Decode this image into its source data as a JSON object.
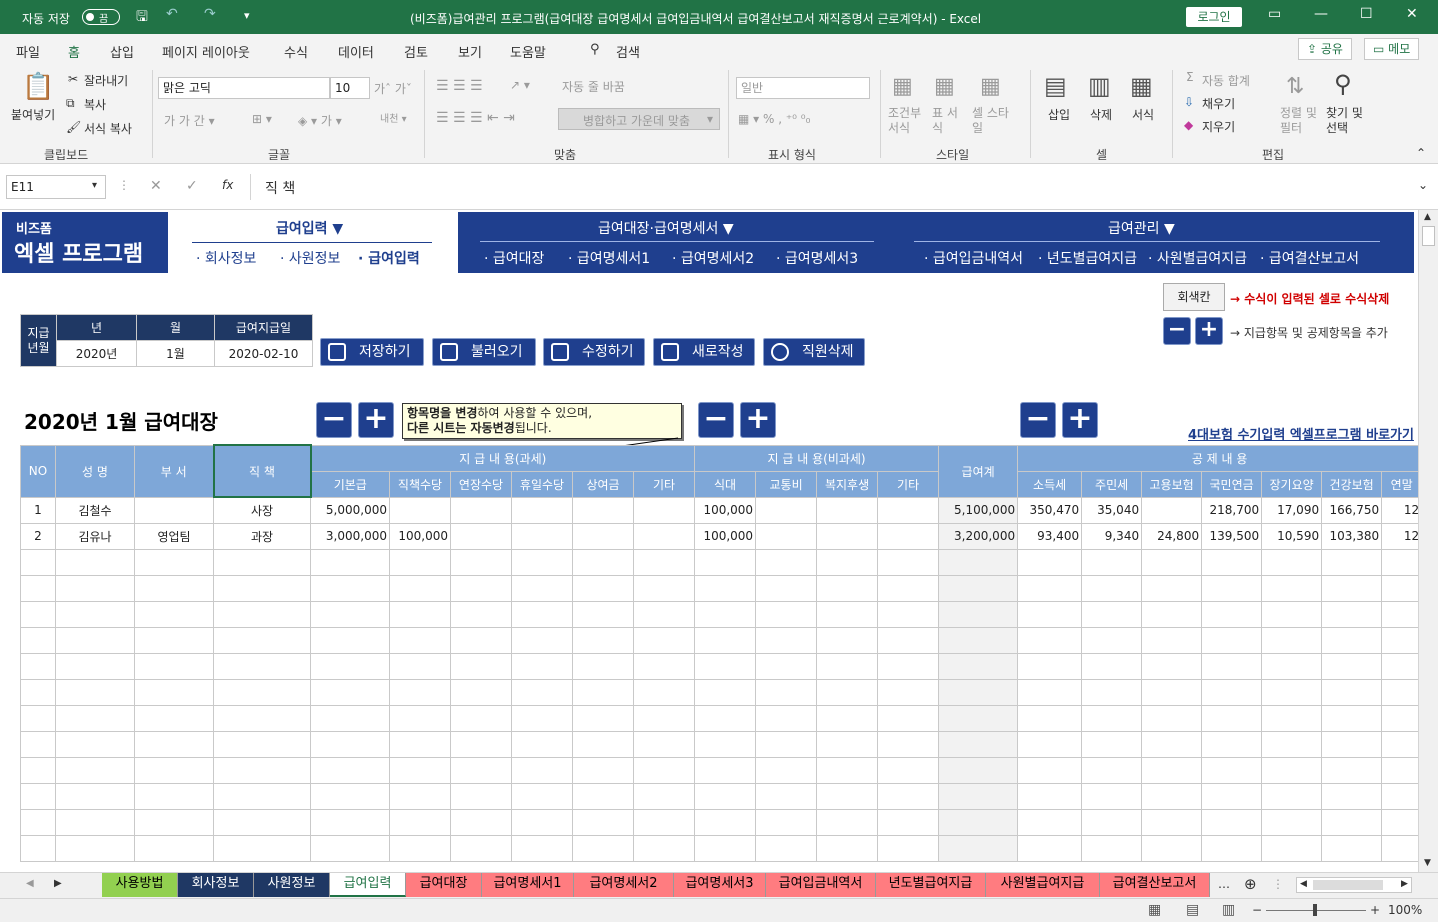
{
  "titlebar": {
    "autosave_label": "자동 저장",
    "autosave_state": "끔",
    "title": "(비즈폼)급여관리 프로그램(급여대장 급여명세서 급여입금내역서 급여결산보고서 재직증명서 근로계약서)  -  Excel",
    "login": "로그인"
  },
  "ribbon_tabs": [
    "파일",
    "홈",
    "삽입",
    "페이지 레이아웃",
    "수식",
    "데이터",
    "검토",
    "보기",
    "도움말",
    "검색"
  ],
  "ribbon_share": "공유",
  "ribbon_memo": "메모",
  "ribbon": {
    "paste": "붙여넣기",
    "cut": "잘라내기",
    "copy": "복사",
    "format_painter": "서식 복사",
    "clipboard": "클립보드",
    "font_name": "맑은 고딕",
    "font_size": "10",
    "font": "글꼴",
    "wrap": "자동 줄 바꿈",
    "merge": "병합하고 가운데 맞춤",
    "align": "맞춤",
    "number_format": "일반",
    "number": "표시 형식",
    "cond_format": "조건부 서식",
    "table_format": "표 서식",
    "cell_style": "셀 스타일",
    "style": "스타일",
    "insert": "삽입",
    "delete": "삭제",
    "format": "서식",
    "cells": "셀",
    "autosum": "자동 합계",
    "fill": "채우기",
    "clear": "지우기",
    "sort": "정렬 및 필터",
    "find": "찾기 및 선택",
    "edit": "편집"
  },
  "formula_bar": {
    "name_box": "E11",
    "fx": "fx",
    "content": "직 책"
  },
  "banner": {
    "logo_small": "비즈폼",
    "logo_big": "엑셀 프로그램",
    "group1_title": "급여입력 ▼",
    "group1_items": [
      "· 회사정보",
      "· 사원정보",
      "· 급여입력"
    ],
    "group2_title": "급여대장·급여명세서 ▼",
    "group2_items": [
      "· 급여대장",
      "· 급여명세서1",
      "· 급여명세서2",
      "· 급여명세서3"
    ],
    "group3_title": "급여관리 ▼",
    "group3_items": [
      "· 급여입금내역서",
      "· 년도별급여지급",
      "· 사원별급여지급",
      "· 급여결산보고서"
    ]
  },
  "legend": {
    "color_cell": "회색칸",
    "formula_note": "→ 수식이 입력된 셀로 수식삭제",
    "addrow_note": "→ 지급항목 및 공제항목을 추가"
  },
  "pay_period": {
    "label1": "지급",
    "label2": "년월",
    "year_h": "년",
    "month_h": "월",
    "date_h": "급여지급일",
    "year": "2020년",
    "month": "1월",
    "date": "2020-02-10"
  },
  "actions": [
    "저장하기",
    "불러오기",
    "수정하기",
    "새로작성",
    "직원삭제"
  ],
  "sheet_title": "2020년 1월 급여대장",
  "note": {
    "line1_bold": "항목명을 변경",
    "line1": "하여 사용할 수 있으며,",
    "line2_bold": "다른 시트는 자동변경",
    "line2": "됩니다."
  },
  "link": "4대보험 수기입력 엑셀프로그램 바로가기",
  "table": {
    "h_no": "NO",
    "h_name": "성 명",
    "h_dept": "부 서",
    "h_pos": "직 책",
    "h_taxable": "지 급 내 용(과세)",
    "h_nontaxable": "지 급 내 용(비과세)",
    "h_total": "급여계",
    "h_deduct": "공 제 내 용",
    "sub_taxable": [
      "기본급",
      "직책수당",
      "연장수당",
      "휴일수당",
      "상여금",
      "기타"
    ],
    "sub_nontaxable": [
      "식대",
      "교통비",
      "복지후생",
      "기타"
    ],
    "sub_deduct": [
      "소득세",
      "주민세",
      "고용보험",
      "국민연금",
      "장기요양",
      "건강보험",
      "연말"
    ],
    "rows": [
      [
        "1",
        "김철수",
        "",
        "사장",
        "5,000,000",
        "",
        "",
        "",
        "",
        "",
        "100,000",
        "",
        "",
        "",
        "5,100,000",
        "350,470",
        "35,040",
        "",
        "218,700",
        "17,090",
        "166,750",
        "12"
      ],
      [
        "2",
        "김유나",
        "영업팀",
        "과장",
        "3,000,000",
        "100,000",
        "",
        "",
        "",
        "",
        "100,000",
        "",
        "",
        "",
        "3,200,000",
        "93,400",
        "9,340",
        "24,800",
        "139,500",
        "10,590",
        "103,380",
        "12"
      ]
    ]
  },
  "sheet_tabs": [
    {
      "label": "사용방법",
      "color": "#92d050"
    },
    {
      "label": "회사정보",
      "color": "#1f3864"
    },
    {
      "label": "사원정보",
      "color": "#1f3864"
    },
    {
      "label": "급여입력",
      "color": "#ffffff"
    },
    {
      "label": "급여대장",
      "color": "#ff7c80"
    },
    {
      "label": "급여명세서1",
      "color": "#ff7c80"
    },
    {
      "label": "급여명세서2",
      "color": "#ff7c80"
    },
    {
      "label": "급여명세서3",
      "color": "#ff7c80"
    },
    {
      "label": "급여입금내역서",
      "color": "#ff7c80"
    },
    {
      "label": "년도별급여지급",
      "color": "#ff7c80"
    },
    {
      "label": "사원별급여지급",
      "color": "#ff7c80"
    },
    {
      "label": "급여결산보고서",
      "color": "#ff7c80"
    }
  ],
  "status": {
    "zoom": "100%"
  }
}
